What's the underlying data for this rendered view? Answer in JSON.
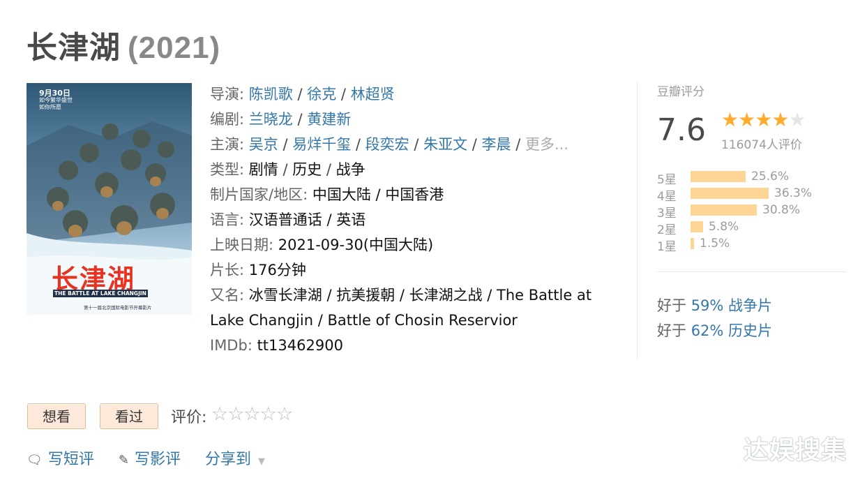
{
  "title": "长津湖",
  "year": "(2021)",
  "poster": {
    "date": "9月30日",
    "tagline_1": "如今繁华盛世",
    "tagline_2": "如你所愿",
    "title": "长津湖",
    "title_en": "THE BATTLE AT LAKE CHANGJIN",
    "bottom_text": "第十一届北京国际电影节开幕影片"
  },
  "info": {
    "director_label": "导演:",
    "directors": [
      "陈凯歌",
      "徐克",
      "林超贤"
    ],
    "writer_label": "编剧:",
    "writers": [
      "兰晓龙",
      "黄建新"
    ],
    "cast_label": "主演:",
    "cast": [
      "吴京",
      "易烊千玺",
      "段奕宏",
      "朱亚文",
      "李晨"
    ],
    "cast_more": "更多...",
    "genre_label": "类型:",
    "genres": [
      "剧情",
      "历史",
      "战争"
    ],
    "country_label": "制片国家/地区:",
    "country_value": "中国大陆 / 中国香港",
    "language_label": "语言:",
    "language_value": "汉语普通话 / 英语",
    "release_label": "上映日期:",
    "release_value": "2021-09-30(中国大陆)",
    "runtime_label": "片长:",
    "runtime_value": "176分钟",
    "aka_label": "又名:",
    "aka_value": "冰雪长津湖 / 抗美援朝 / 长津湖之战 / The Battle at Lake Changjin / Battle of Chosin Reservior",
    "imdb_label": "IMDb:",
    "imdb_value": "tt13462900"
  },
  "rating": {
    "label": "豆瓣评分",
    "score": "7.6",
    "stars_filled": 4,
    "stars_total": 5,
    "votes": "116074人评价",
    "distribution": [
      {
        "label": "5星",
        "percent": 25.6,
        "text": "25.6%"
      },
      {
        "label": "4星",
        "percent": 36.3,
        "text": "36.3%"
      },
      {
        "label": "3星",
        "percent": 30.8,
        "text": "30.8%"
      },
      {
        "label": "2星",
        "percent": 5.8,
        "text": "5.8%"
      },
      {
        "label": "1星",
        "percent": 1.5,
        "text": "1.5%"
      }
    ],
    "better_than": [
      {
        "prefix": "好于",
        "value": "59% 战争片"
      },
      {
        "prefix": "好于",
        "value": "62% 历史片"
      }
    ]
  },
  "actions": {
    "want_label": "想看",
    "seen_label": "看过",
    "rate_label": "评价:",
    "rate_stars": "☆☆☆☆☆",
    "short_review": "写短评",
    "review": "写影评",
    "share": "分享到"
  },
  "watermark": "达娱搜集",
  "colors": {
    "link": "#3377aa",
    "star": "#ffac2d",
    "bar": "#ffd596",
    "button_bg": "#fde9d9"
  }
}
